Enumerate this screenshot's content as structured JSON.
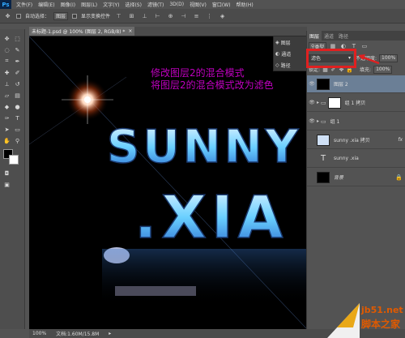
{
  "app": {
    "logo": "Ps"
  },
  "menu": {
    "items": [
      "文件(F)",
      "编辑(E)",
      "图像(I)",
      "图层(L)",
      "文字(Y)",
      "选择(S)",
      "滤镜(T)",
      "3D(D)",
      "视图(V)",
      "窗口(W)",
      "帮助(H)"
    ]
  },
  "options": {
    "auto_select": "自动选择：",
    "auto_select_target": "图层",
    "show_transform": "显示变换控件"
  },
  "document": {
    "tab_title": "未标题-1.psd @ 100% (图层 2, RGB/8) *"
  },
  "canvas": {
    "artwork": {
      "line1": "SUNNY",
      "line2": ".XIA"
    },
    "annotation_line1": "修改图层2的混合模式",
    "annotation_line2": "将图层2的混合模式改为滤色"
  },
  "mini_panel": {
    "items": [
      {
        "icon": "cube-icon",
        "label": "图层"
      },
      {
        "icon": "circle-half-icon",
        "label": "通道"
      },
      {
        "icon": "path-icon",
        "label": "路径"
      }
    ]
  },
  "layers_panel": {
    "tabs": [
      "图层",
      "通道",
      "路径"
    ],
    "kind_label": "类型",
    "blend_mode": "滤色",
    "opacity_label": "不透明度:",
    "opacity": "100%",
    "lock_label": "锁定:",
    "fill_label": "填充:",
    "fill": "100%",
    "layers": [
      {
        "name": "图层 2",
        "thumb": "#000000",
        "selected": true
      },
      {
        "name": "组 1 拷贝",
        "thumb": "#ffffff",
        "type": "group"
      },
      {
        "name": "组 1",
        "type": "group"
      },
      {
        "name": "sunny .xia 拷贝",
        "thumb": "#cfe0f5",
        "fx": "fx"
      },
      {
        "name": "sunny .xia",
        "type": "text"
      },
      {
        "name": "背景",
        "thumb": "#000000"
      }
    ]
  },
  "status": {
    "zoom": "100%",
    "doc_size": "文档:1.60M/15.8M"
  },
  "watermark": {
    "line1": "jb51.net",
    "line2": "脚本之家"
  },
  "colors": {
    "accent_red": "#e02020",
    "annotation_magenta": "#c000c0",
    "selected_layer": "#6b7f96"
  }
}
